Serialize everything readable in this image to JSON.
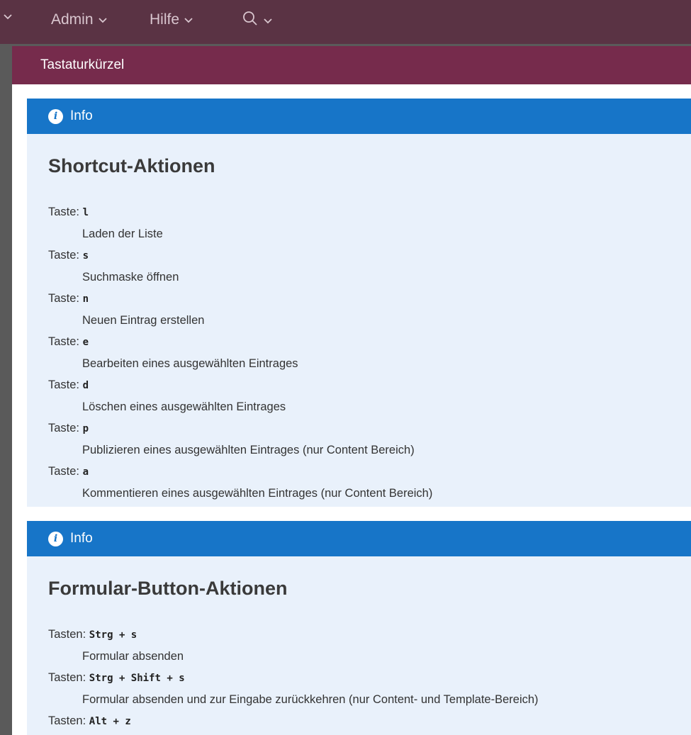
{
  "menu": {
    "items": [
      {
        "label": "Admin"
      },
      {
        "label": "Hilfe"
      }
    ]
  },
  "panel": {
    "title": "Tastaturkürzel"
  },
  "info_label": "Info",
  "shortcut_section": {
    "heading": "Shortcut-Aktionen",
    "entries": [
      {
        "prefix": "Taste:",
        "key": "l",
        "desc": "Laden der Liste"
      },
      {
        "prefix": "Taste:",
        "key": "s",
        "desc": "Suchmaske öffnen"
      },
      {
        "prefix": "Taste:",
        "key": "n",
        "desc": "Neuen Eintrag erstellen"
      },
      {
        "prefix": "Taste:",
        "key": "e",
        "desc": "Bearbeiten eines ausgewählten Eintrages"
      },
      {
        "prefix": "Taste:",
        "key": "d",
        "desc": "Löschen eines ausgewählten Eintrages"
      },
      {
        "prefix": "Taste:",
        "key": "p",
        "desc": "Publizieren eines ausgewählten Eintrages (nur Content Bereich)"
      },
      {
        "prefix": "Taste:",
        "key": "a",
        "desc": "Kommentieren eines ausgewählten Eintrages (nur Content Bereich)"
      }
    ]
  },
  "form_section": {
    "heading": "Formular-Button-Aktionen",
    "entries": [
      {
        "prefix": "Tasten:",
        "key": "Strg + s",
        "desc": "Formular absenden"
      },
      {
        "prefix": "Tasten:",
        "key": "Strg + Shift + s",
        "desc": "Formular absenden und zur Eingabe zurückkehren (nur Content- und Template-Bereich)"
      },
      {
        "prefix": "Tasten:",
        "key": "Alt + z",
        "desc": ""
      }
    ]
  },
  "colors": {
    "topbar": "#5a3344",
    "panel_header": "#762b4c",
    "info_header": "#1775c8",
    "info_body": "#e9f1fb"
  },
  "icons": [
    "chevron-down-icon",
    "search-icon",
    "info-icon"
  ]
}
